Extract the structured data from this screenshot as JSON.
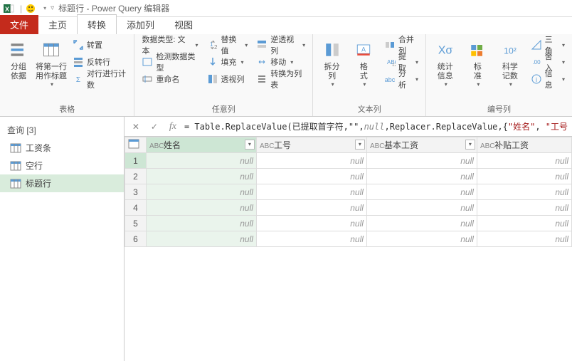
{
  "titlebar": {
    "sep": "|",
    "text": "标题行 - Power Query 编辑器"
  },
  "tabs": {
    "file": "文件",
    "home": "主页",
    "transform": "转换",
    "addcol": "添加列",
    "view": "视图"
  },
  "ribbon": {
    "group_table": {
      "groupby": "分组\n依据",
      "firstrow": "将第一行\n用作标题",
      "transpose": "转置",
      "reverse": "反转行",
      "count": "对行进行计数",
      "label": "表格"
    },
    "group_any": {
      "datatype": "数据类型: 文本",
      "detect": "检测数据类型",
      "rename": "重命名",
      "replace": "替换值",
      "fill": "填充",
      "pivot": "透视列",
      "unpivot": "逆透视列",
      "move": "移动",
      "tolist": "转换为列表",
      "label": "任意列"
    },
    "group_text": {
      "split": "拆分\n列",
      "format": "格\n式",
      "merge": "合并列",
      "extract": "提取",
      "parse": "分析",
      "label": "文本列"
    },
    "group_num": {
      "stats": "统计\n信息",
      "standard": "标\n准",
      "sci": "科学\n记数",
      "trig": "三角",
      "round": "舍入",
      "info": "信息",
      "label": "编号列"
    }
  },
  "sidebar": {
    "header": "查询 [3]",
    "items": [
      {
        "label": "工资条"
      },
      {
        "label": "空行"
      },
      {
        "label": "标题行"
      }
    ]
  },
  "formula": {
    "prefix": "= Table.ReplaceValue(已提取首字符,\"\",",
    "null": "null",
    "mid": ",Replacer.ReplaceValue,{",
    "s1": "\"姓名\"",
    "c1": ", ",
    "s2": "\"工号"
  },
  "grid": {
    "columns": [
      "姓名",
      "工号",
      "基本工资",
      "补贴工资"
    ],
    "type_icon": "ABC",
    "nullText": "null",
    "rowCount": 6
  }
}
